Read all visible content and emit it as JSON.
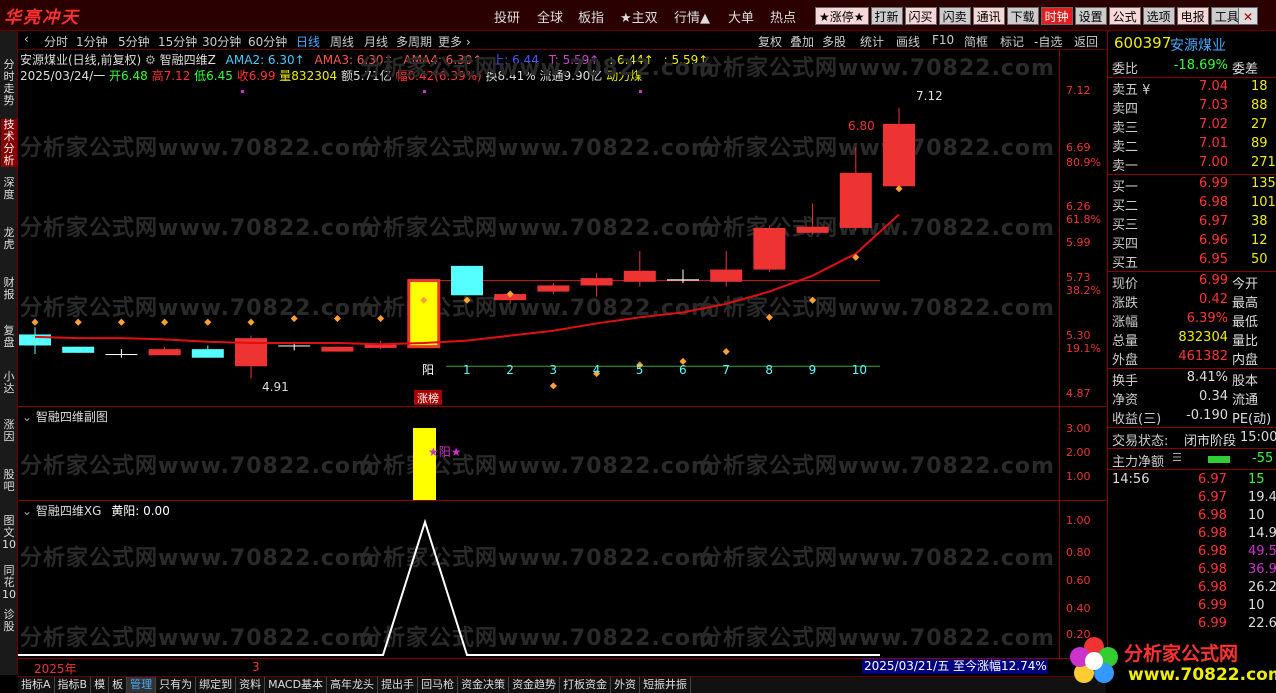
{
  "app": {
    "logo": "华亮冲天"
  },
  "top_menu": [
    "投研",
    "全球",
    "板指",
    "★主双",
    "行情▲",
    "大单",
    "热点"
  ],
  "tool_buttons": [
    {
      "label": "★涨停★",
      "style": "pink"
    },
    {
      "label": "打新",
      "style": "plain"
    },
    {
      "label": "闪买",
      "style": "pink"
    },
    {
      "label": "闪卖",
      "style": "plain"
    },
    {
      "label": "通讯",
      "style": "pink"
    },
    {
      "label": "下载",
      "style": "plain"
    },
    {
      "label": "时钟",
      "style": "red"
    },
    {
      "label": "设置",
      "style": "plain"
    },
    {
      "label": "公式",
      "style": "pink"
    },
    {
      "label": "选项",
      "style": "plain"
    },
    {
      "label": "电报",
      "style": "pink"
    },
    {
      "label": "工具",
      "style": "plain"
    }
  ],
  "close_label": "✕",
  "left_tabs": [
    "分时走势",
    "技术分析",
    "深度",
    "龙虎",
    "财报",
    "复盘",
    "小达",
    "涨因",
    "股吧",
    "图文10",
    "同花10",
    "诊股"
  ],
  "period_bar": {
    "items": [
      "分时",
      "1分钟",
      "5分钟",
      "15分钟",
      "30分钟",
      "60分钟",
      "日线",
      "周线",
      "月线",
      "多周期",
      "更多 ›"
    ],
    "active": "日线",
    "right_items": [
      "复权",
      "叠加",
      "多股",
      "统计",
      "画线",
      "F10",
      "简框",
      "标记",
      "-自选",
      "返回"
    ]
  },
  "info": {
    "stock_title": "安源煤业(日线,前复权)",
    "indicator": "智融四维Z",
    "ama2": "AMA2: 6.30↑",
    "ama3": "AMA3: 6.30↑",
    "ama4": "AMA4: 6.30↑",
    "up": "上: 6.44",
    "t": "T: 5.59↑",
    "v1": ": 6.44↑",
    "v2": ": 5.59↑"
  },
  "ohlc": {
    "date": "2025/03/24/一",
    "open": "开6.48",
    "high": "高7.12",
    "low": "低6.45",
    "close": "收6.99",
    "vol": "量832304",
    "amt": "额5.71亿",
    "chg": "幅0.42(6.39%)",
    "turn": "换8.41%",
    "float": "流通9.90亿",
    "sector": "动力煤"
  },
  "price_axis": [
    {
      "label": "7.12",
      "color": "#e33"
    },
    {
      "label": "6.69",
      "color": "#e33"
    },
    {
      "label": "80.9%",
      "color": "#e33"
    },
    {
      "label": "6.26",
      "color": "#e33"
    },
    {
      "label": "61.8%",
      "color": "#e33"
    },
    {
      "label": "5.99",
      "color": "#e33"
    },
    {
      "label": "5.73",
      "color": "#e33"
    },
    {
      "label": "38.2%",
      "color": "#e33"
    },
    {
      "label": "5.30",
      "color": "#e33"
    },
    {
      "label": "19.1%",
      "color": "#e33"
    },
    {
      "label": "4.87",
      "color": "#e33"
    }
  ],
  "chart_labels": {
    "high_mark": "7.12",
    "mark_680": "6.80",
    "low_mark": "4.91",
    "yang": "阳",
    "zhangbang": "涨榜",
    "counters": [
      "1",
      "2",
      "3",
      "4",
      "5",
      "6",
      "7",
      "8",
      "9",
      "10"
    ]
  },
  "sub1": {
    "title": "智融四维副图",
    "axis": [
      "3.00",
      "2.00",
      "1.00"
    ],
    "star": "★阳★"
  },
  "sub2": {
    "title": "智融四维XG",
    "field": "黄阳: 0.00",
    "axis": [
      "1.00",
      "0.80",
      "0.60",
      "0.40",
      "0.20"
    ]
  },
  "bottom": {
    "year": "2025年",
    "month": "3",
    "date_badge": "2025/03/21/五 至今涨幅12.74%"
  },
  "bottom_tabs": [
    "指标A",
    "指标B",
    "模",
    "板",
    "管理",
    "只有为",
    "绑定到",
    "资料",
    "MACD基本",
    "高年龙头",
    "提出手",
    "回马枪",
    "资金决策",
    "资金趋势",
    "打板资金",
    "外资",
    "短振井振"
  ],
  "bottom_active": "管理",
  "quote": {
    "code": "600397",
    "name": "安源煤业",
    "weibi_label": "委比",
    "weibi": "-18.69%",
    "weicha_label": "委差",
    "asks": [
      {
        "k": "卖五 ¥",
        "p": "7.04",
        "q": "18"
      },
      {
        "k": "卖四",
        "p": "7.03",
        "q": "88"
      },
      {
        "k": "卖三",
        "p": "7.02",
        "q": "27"
      },
      {
        "k": "卖二",
        "p": "7.01",
        "q": "89"
      },
      {
        "k": "卖一",
        "p": "7.00",
        "q": "271"
      }
    ],
    "bids": [
      {
        "k": "买一",
        "p": "6.99",
        "q": "135"
      },
      {
        "k": "买二",
        "p": "6.98",
        "q": "101"
      },
      {
        "k": "买三",
        "p": "6.97",
        "q": "38"
      },
      {
        "k": "买四",
        "p": "6.96",
        "q": "12"
      },
      {
        "k": "买五",
        "p": "6.95",
        "q": "50"
      }
    ],
    "stats": [
      {
        "k": "现价",
        "v": "6.99",
        "k2": "今开",
        "c": "#f33"
      },
      {
        "k": "涨跌",
        "v": "0.42",
        "k2": "最高",
        "c": "#f33"
      },
      {
        "k": "涨幅",
        "v": "6.39%",
        "k2": "最低",
        "c": "#f33"
      },
      {
        "k": "总量",
        "v": "832304",
        "k2": "量比",
        "c": "#ee0"
      },
      {
        "k": "外盘",
        "v": "461382",
        "k2": "内盘",
        "c": "#f33"
      }
    ],
    "stats2": [
      {
        "k": "换手",
        "v": "8.41%",
        "k2": "股本",
        "c": "#ddd"
      },
      {
        "k": "净资",
        "v": "0.34",
        "k2": "流通",
        "c": "#ddd"
      },
      {
        "k": "收益(三)",
        "v": "-0.190",
        "k2": "PE(动)",
        "c": "#ddd"
      }
    ],
    "status_label": "交易状态:",
    "status": "闭市阶段",
    "status_time": "15:00",
    "mainflow_label": "主力净额",
    "mainflow": "-55",
    "ticks": [
      {
        "t": "14:56",
        "p": "6.97",
        "v": "15",
        "c": "#3f3"
      },
      {
        "t": "",
        "p": "6.97",
        "v": "19.4",
        "c": "#ddd"
      },
      {
        "t": "",
        "p": "6.98",
        "v": "10",
        "c": "#ddd"
      },
      {
        "t": "",
        "p": "6.98",
        "v": "14.9",
        "c": "#ddd"
      },
      {
        "t": "",
        "p": "6.98",
        "v": "49.5",
        "c": "#c3c"
      },
      {
        "t": "",
        "p": "6.98",
        "v": "36.9",
        "c": "#c3c"
      },
      {
        "t": "",
        "p": "6.98",
        "v": "26.2",
        "c": "#ddd"
      },
      {
        "t": "",
        "p": "6.99",
        "v": "10",
        "c": "#ddd"
      },
      {
        "t": "",
        "p": "6.99",
        "v": "22.6",
        "c": "#ddd"
      }
    ]
  },
  "watermark": "分析家公式网www.70822.com",
  "brand": {
    "title": "分析家公式网",
    "url": "www.70822.com"
  },
  "colors": {
    "up": "#f33",
    "down": "#4ff",
    "accent": "#e02020",
    "ma": "#e01010",
    "yellow": "#ff0",
    "orange": "#ffa030"
  },
  "chart_data": {
    "type": "candlestick",
    "title": "安源煤业(日线,前复权)",
    "candles": [
      {
        "o": 5.18,
        "c": 5.27,
        "h": 5.33,
        "l": 5.11,
        "color": "cyan"
      },
      {
        "o": 5.17,
        "c": 5.12,
        "h": 5.17,
        "l": 5.12,
        "color": "cyan"
      },
      {
        "o": 5.11,
        "c": 5.11,
        "h": 5.15,
        "l": 5.08,
        "color": "white"
      },
      {
        "o": 5.15,
        "c": 5.1,
        "h": 5.17,
        "l": 5.1,
        "color": "red"
      },
      {
        "o": 5.15,
        "c": 5.08,
        "h": 5.18,
        "l": 5.08,
        "color": "cyan"
      },
      {
        "o": 5.24,
        "c": 5.01,
        "h": 5.26,
        "l": 4.91,
        "color": "red"
      },
      {
        "o": 5.18,
        "c": 5.18,
        "h": 5.21,
        "l": 5.14,
        "color": "white"
      },
      {
        "o": 5.17,
        "c": 5.13,
        "h": 5.17,
        "l": 5.13,
        "color": "red"
      },
      {
        "o": 5.16,
        "c": 5.19,
        "h": 5.22,
        "l": 5.15,
        "color": "red"
      },
      {
        "o": 5.17,
        "c": 5.71,
        "h": 5.71,
        "l": 5.17,
        "color": "yellow"
      },
      {
        "o": 5.59,
        "c": 5.83,
        "h": 5.83,
        "l": 5.59,
        "color": "cyan"
      },
      {
        "o": 5.55,
        "c": 5.6,
        "h": 5.62,
        "l": 5.52,
        "color": "red"
      },
      {
        "o": 5.62,
        "c": 5.67,
        "h": 5.69,
        "l": 5.6,
        "color": "red"
      },
      {
        "o": 5.67,
        "c": 5.73,
        "h": 5.77,
        "l": 5.58,
        "color": "red"
      },
      {
        "o": 5.7,
        "c": 5.79,
        "h": 5.95,
        "l": 5.66,
        "color": "red"
      },
      {
        "o": 5.71,
        "c": 5.72,
        "h": 5.8,
        "l": 5.69,
        "color": "white"
      },
      {
        "o": 5.7,
        "c": 5.8,
        "h": 5.95,
        "l": 5.66,
        "color": "red"
      },
      {
        "o": 5.8,
        "c": 6.14,
        "h": 6.16,
        "l": 5.78,
        "color": "red"
      },
      {
        "o": 6.1,
        "c": 6.15,
        "h": 6.34,
        "l": 6.09,
        "color": "red"
      },
      {
        "o": 6.14,
        "c": 6.59,
        "h": 6.8,
        "l": 6.12,
        "color": "red"
      },
      {
        "o": 6.48,
        "c": 6.99,
        "h": 7.12,
        "l": 6.45,
        "color": "red"
      }
    ],
    "ma": [
      5.25,
      5.24,
      5.24,
      5.23,
      5.21,
      5.2,
      5.2,
      5.2,
      5.19,
      5.2,
      5.22,
      5.26,
      5.3,
      5.36,
      5.41,
      5.45,
      5.52,
      5.62,
      5.75,
      5.93,
      6.25
    ],
    "dots": [
      5.37,
      5.37,
      5.37,
      5.37,
      5.37,
      5.37,
      5.4,
      5.4,
      5.4,
      5.55,
      5.55,
      5.6,
      4.85,
      4.95,
      5.02,
      5.05,
      5.13,
      5.41,
      5.55,
      5.9,
      6.46
    ],
    "ref_lines": [
      5.71,
      5.1
    ],
    "ylim": [
      4.8,
      7.25
    ]
  }
}
